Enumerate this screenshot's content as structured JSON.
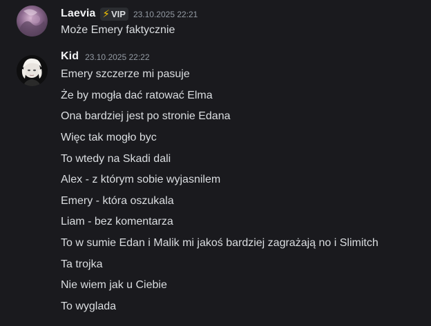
{
  "messages": [
    {
      "username": "Laevia",
      "badge": {
        "icon": "lightning-bolt-icon",
        "glyph": "⚡",
        "label": "VIP",
        "icon_color": "#f5c400"
      },
      "timestamp": "23.10.2025 22:21",
      "lines": [
        "Może Emery faktycznie"
      ]
    },
    {
      "username": "Kid",
      "timestamp": "23.10.2025 22:22",
      "lines": [
        "Emery szczerze mi pasuje",
        "Że by mogła dać ratować Elma",
        "Ona bardziej jest po stronie Edana",
        "Więc tak mogło byc",
        "To wtedy na Skadi dali",
        "Alex - z którym sobie wyjasnilem",
        "Emery - która oszukala",
        "Liam - bez komentarza",
        "To w sumie Edan i Malik mi jakoś bardziej zagrażają no i Slimitch",
        "Ta trojka",
        "Nie wiem jak u Ciebie",
        "To wyglada"
      ]
    }
  ],
  "colors": {
    "background": "#1a1a1e",
    "text": "#dbdee1",
    "username": "#f2f3f5",
    "timestamp": "#949ba4",
    "badge_background": "#2b2d31"
  }
}
